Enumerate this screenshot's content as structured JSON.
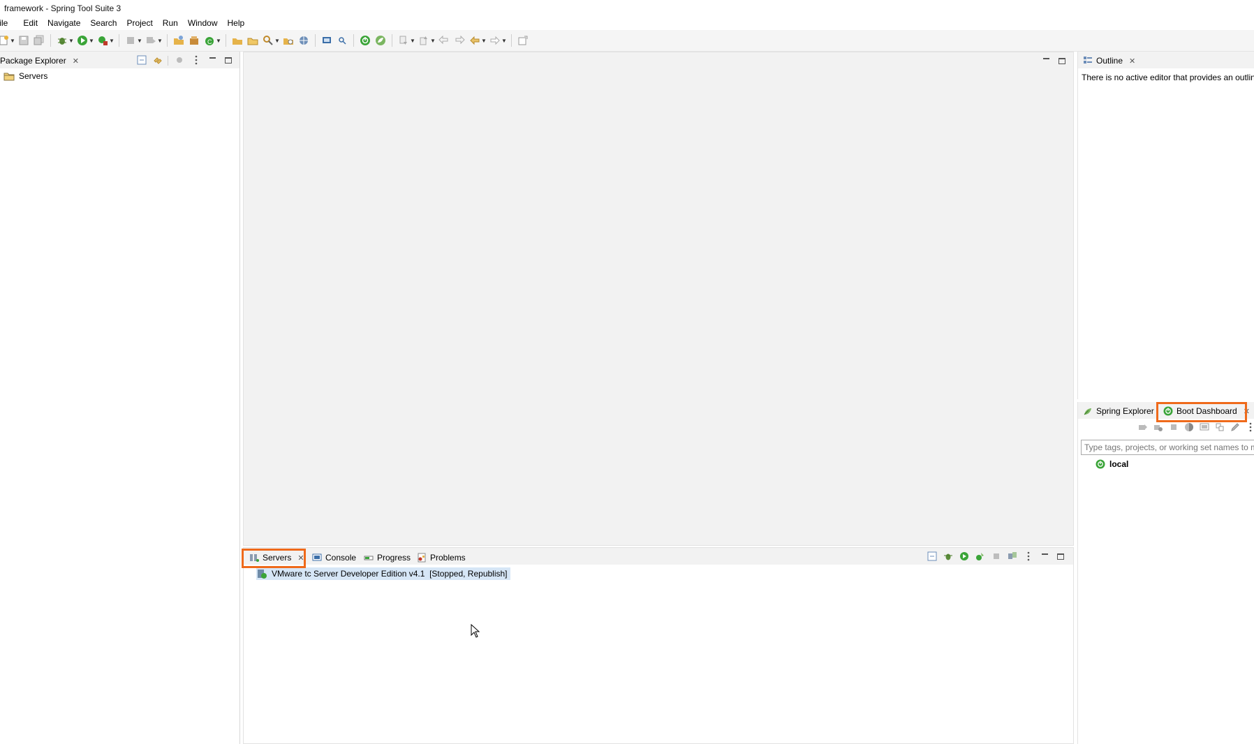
{
  "window": {
    "title": "framework - Spring Tool Suite 3"
  },
  "menu": [
    "File",
    "Edit",
    "Navigate",
    "Search",
    "Project",
    "Run",
    "Window",
    "Help"
  ],
  "package_explorer": {
    "tab_label": "Package Explorer",
    "items": [
      {
        "label": "Servers",
        "icon": "folder-icon"
      }
    ]
  },
  "outline": {
    "tab_label": "Outline",
    "message": "There is no active editor that provides an outline."
  },
  "right_bottom": {
    "tabs": [
      {
        "label": "Spring Explorer",
        "icon": "spring-leaf-icon"
      },
      {
        "label": "Boot Dashboard",
        "icon": "boot-power-icon",
        "highlighted": true
      }
    ],
    "filter_placeholder": "Type tags, projects, or working set names to match",
    "items": [
      {
        "label": "local",
        "icon": "boot-power-icon"
      }
    ]
  },
  "bottom_panel": {
    "tabs": [
      {
        "label": "Servers",
        "icon": "servers-icon",
        "highlighted": true
      },
      {
        "label": "Console",
        "icon": "console-icon"
      },
      {
        "label": "Progress",
        "icon": "progress-icon"
      },
      {
        "label": "Problems",
        "icon": "problems-icon"
      }
    ],
    "servers": [
      {
        "label": "VMware tc Server Developer Edition v4.1  [Stopped, Republish]"
      }
    ]
  },
  "colors": {
    "highlight": "#ef6a1b",
    "spring_green": "#3aa438",
    "selection": "#d6e6f6"
  }
}
